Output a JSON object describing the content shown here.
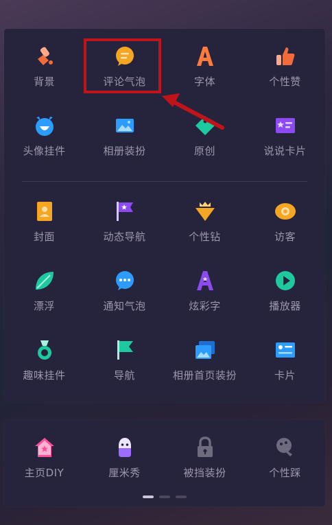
{
  "main_section_1": [
    {
      "label": "背景",
      "icon": "brush-icon"
    },
    {
      "label": "评论气泡",
      "icon": "comment-bubble-icon"
    },
    {
      "label": "字体",
      "icon": "font-icon"
    },
    {
      "label": "个性赞",
      "icon": "thumbs-up-icon"
    },
    {
      "label": "头像挂件",
      "icon": "avatar-pendant-icon"
    },
    {
      "label": "相册装扮",
      "icon": "album-icon"
    },
    {
      "label": "原创",
      "icon": "original-tag-icon"
    },
    {
      "label": "说说卡片",
      "icon": "post-card-icon"
    }
  ],
  "main_section_2": [
    {
      "label": "封面",
      "icon": "cover-icon"
    },
    {
      "label": "动态导航",
      "icon": "flag-icon"
    },
    {
      "label": "个性钻",
      "icon": "diamond-icon"
    },
    {
      "label": "访客",
      "icon": "visitor-icon"
    },
    {
      "label": "漂浮",
      "icon": "leaf-icon"
    },
    {
      "label": "通知气泡",
      "icon": "notification-bubble-icon"
    },
    {
      "label": "炫彩字",
      "icon": "colorful-font-icon"
    },
    {
      "label": "播放器",
      "icon": "play-icon"
    },
    {
      "label": "趣味挂件",
      "icon": "medal-icon"
    },
    {
      "label": "导航",
      "icon": "navigation-flag-icon"
    },
    {
      "label": "相册首页装扮",
      "icon": "album-home-icon"
    },
    {
      "label": "卡片",
      "icon": "card-icon"
    }
  ],
  "bottom_section": [
    {
      "label": "主页DIY",
      "icon": "home-diy-icon"
    },
    {
      "label": "厘米秀",
      "icon": "cmshow-icon"
    },
    {
      "label": "被挡装扮",
      "icon": "lock-icon"
    },
    {
      "label": "个性踩",
      "icon": "footprint-icon"
    }
  ],
  "colors": {
    "panel": "#26233d",
    "label": "#9c98ad",
    "accent_orange": "#f5a623",
    "highlight": "#c0141b"
  }
}
